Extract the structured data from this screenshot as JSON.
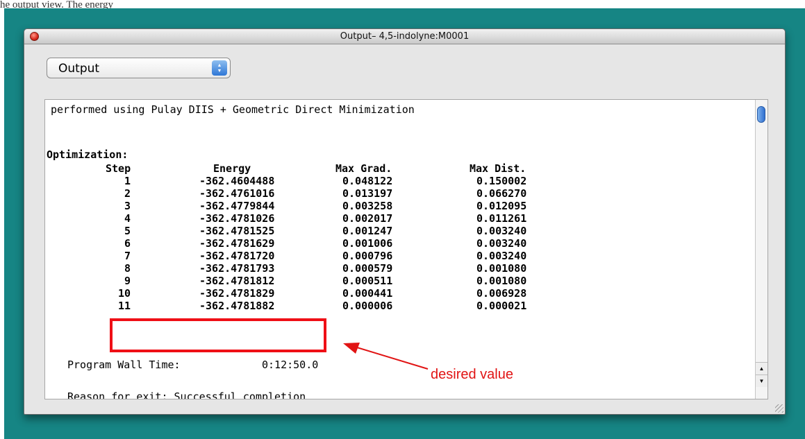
{
  "caption_fragment": "he output view. The energy",
  "window": {
    "title": "Output– 4,5-indolyne:M0001"
  },
  "dropdown": {
    "label": "Output"
  },
  "output": {
    "method_line": "performed using Pulay DIIS + Geometric Direct Minimization",
    "section_title": "Optimization:",
    "columns": [
      "Step",
      "Energy",
      "Max Grad.",
      "Max Dist."
    ],
    "rows": [
      [
        "1",
        "-362.4604488",
        "0.048122",
        "0.150002"
      ],
      [
        "2",
        "-362.4761016",
        "0.013197",
        "0.066270"
      ],
      [
        "3",
        "-362.4779844",
        "0.003258",
        "0.012095"
      ],
      [
        "4",
        "-362.4781026",
        "0.002017",
        "0.011261"
      ],
      [
        "5",
        "-362.4781525",
        "0.001247",
        "0.003240"
      ],
      [
        "6",
        "-362.4781629",
        "0.001006",
        "0.003240"
      ],
      [
        "7",
        "-362.4781720",
        "0.000796",
        "0.003240"
      ],
      [
        "8",
        "-362.4781793",
        "0.000579",
        "0.001080"
      ],
      [
        "9",
        "-362.4781812",
        "0.000511",
        "0.001080"
      ],
      [
        "10",
        "-362.4781829",
        "0.000441",
        "0.006928"
      ],
      [
        "11",
        "-362.4781882",
        "0.000006",
        "0.000021"
      ]
    ],
    "wall_time_label": "Program Wall Time:",
    "wall_time_value": "0:12:50.0",
    "exit_line": "Reason for exit: Successful completion"
  },
  "annotation": {
    "text": "desired value",
    "color": "#e11414"
  },
  "colors": {
    "desktop": "#168584",
    "highlight": "#ef0f16"
  },
  "icons": [
    "close-icon",
    "select-arrows-icon",
    "scroll-up-icon",
    "scroll-down-icon",
    "resize-grip-icon",
    "arrow-icon"
  ]
}
